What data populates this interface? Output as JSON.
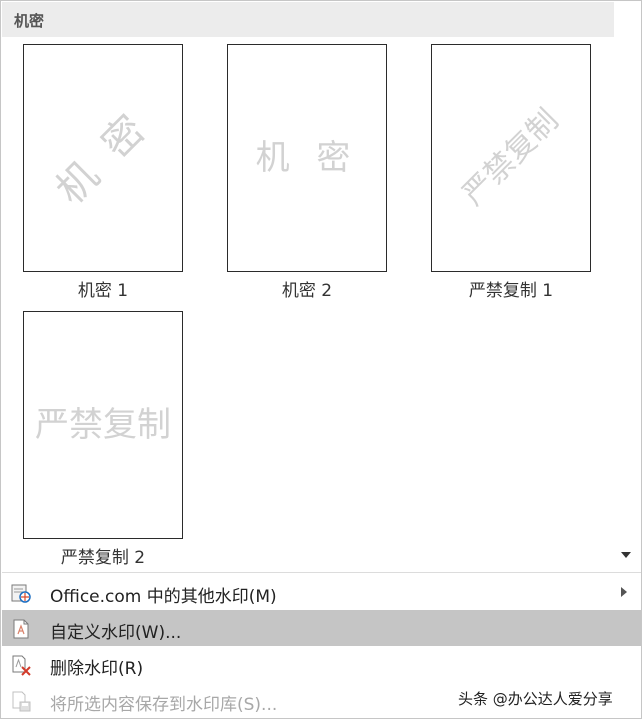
{
  "gallery": {
    "section_title": "机密",
    "items": [
      {
        "caption": "机密 1",
        "watermark": "机 密"
      },
      {
        "caption": "机密 2",
        "watermark": "机 密"
      },
      {
        "caption": "严禁复制 1",
        "watermark": "严禁复制"
      },
      {
        "caption": "严禁复制 2",
        "watermark": "严禁复制"
      }
    ]
  },
  "menu": {
    "items": [
      {
        "label": "Office.com 中的其他水印(M)",
        "icon": "office-watermark-icon",
        "has_submenu": true,
        "enabled": true
      },
      {
        "label": "自定义水印(W)...",
        "icon": "custom-watermark-icon",
        "highlighted": true,
        "enabled": true
      },
      {
        "label": "删除水印(R)",
        "icon": "remove-watermark-icon",
        "enabled": true
      },
      {
        "label": "将所选内容保存到水印库(S)...",
        "icon": "save-to-gallery-icon",
        "enabled": false
      }
    ]
  },
  "brand_text": "头条 @办公达人爱分享",
  "colors": {
    "highlight": "#c5c5c5",
    "header_bg": "#ececec",
    "watermark_text": "#d2d2d2",
    "disabled_text": "#a8a8a8"
  }
}
